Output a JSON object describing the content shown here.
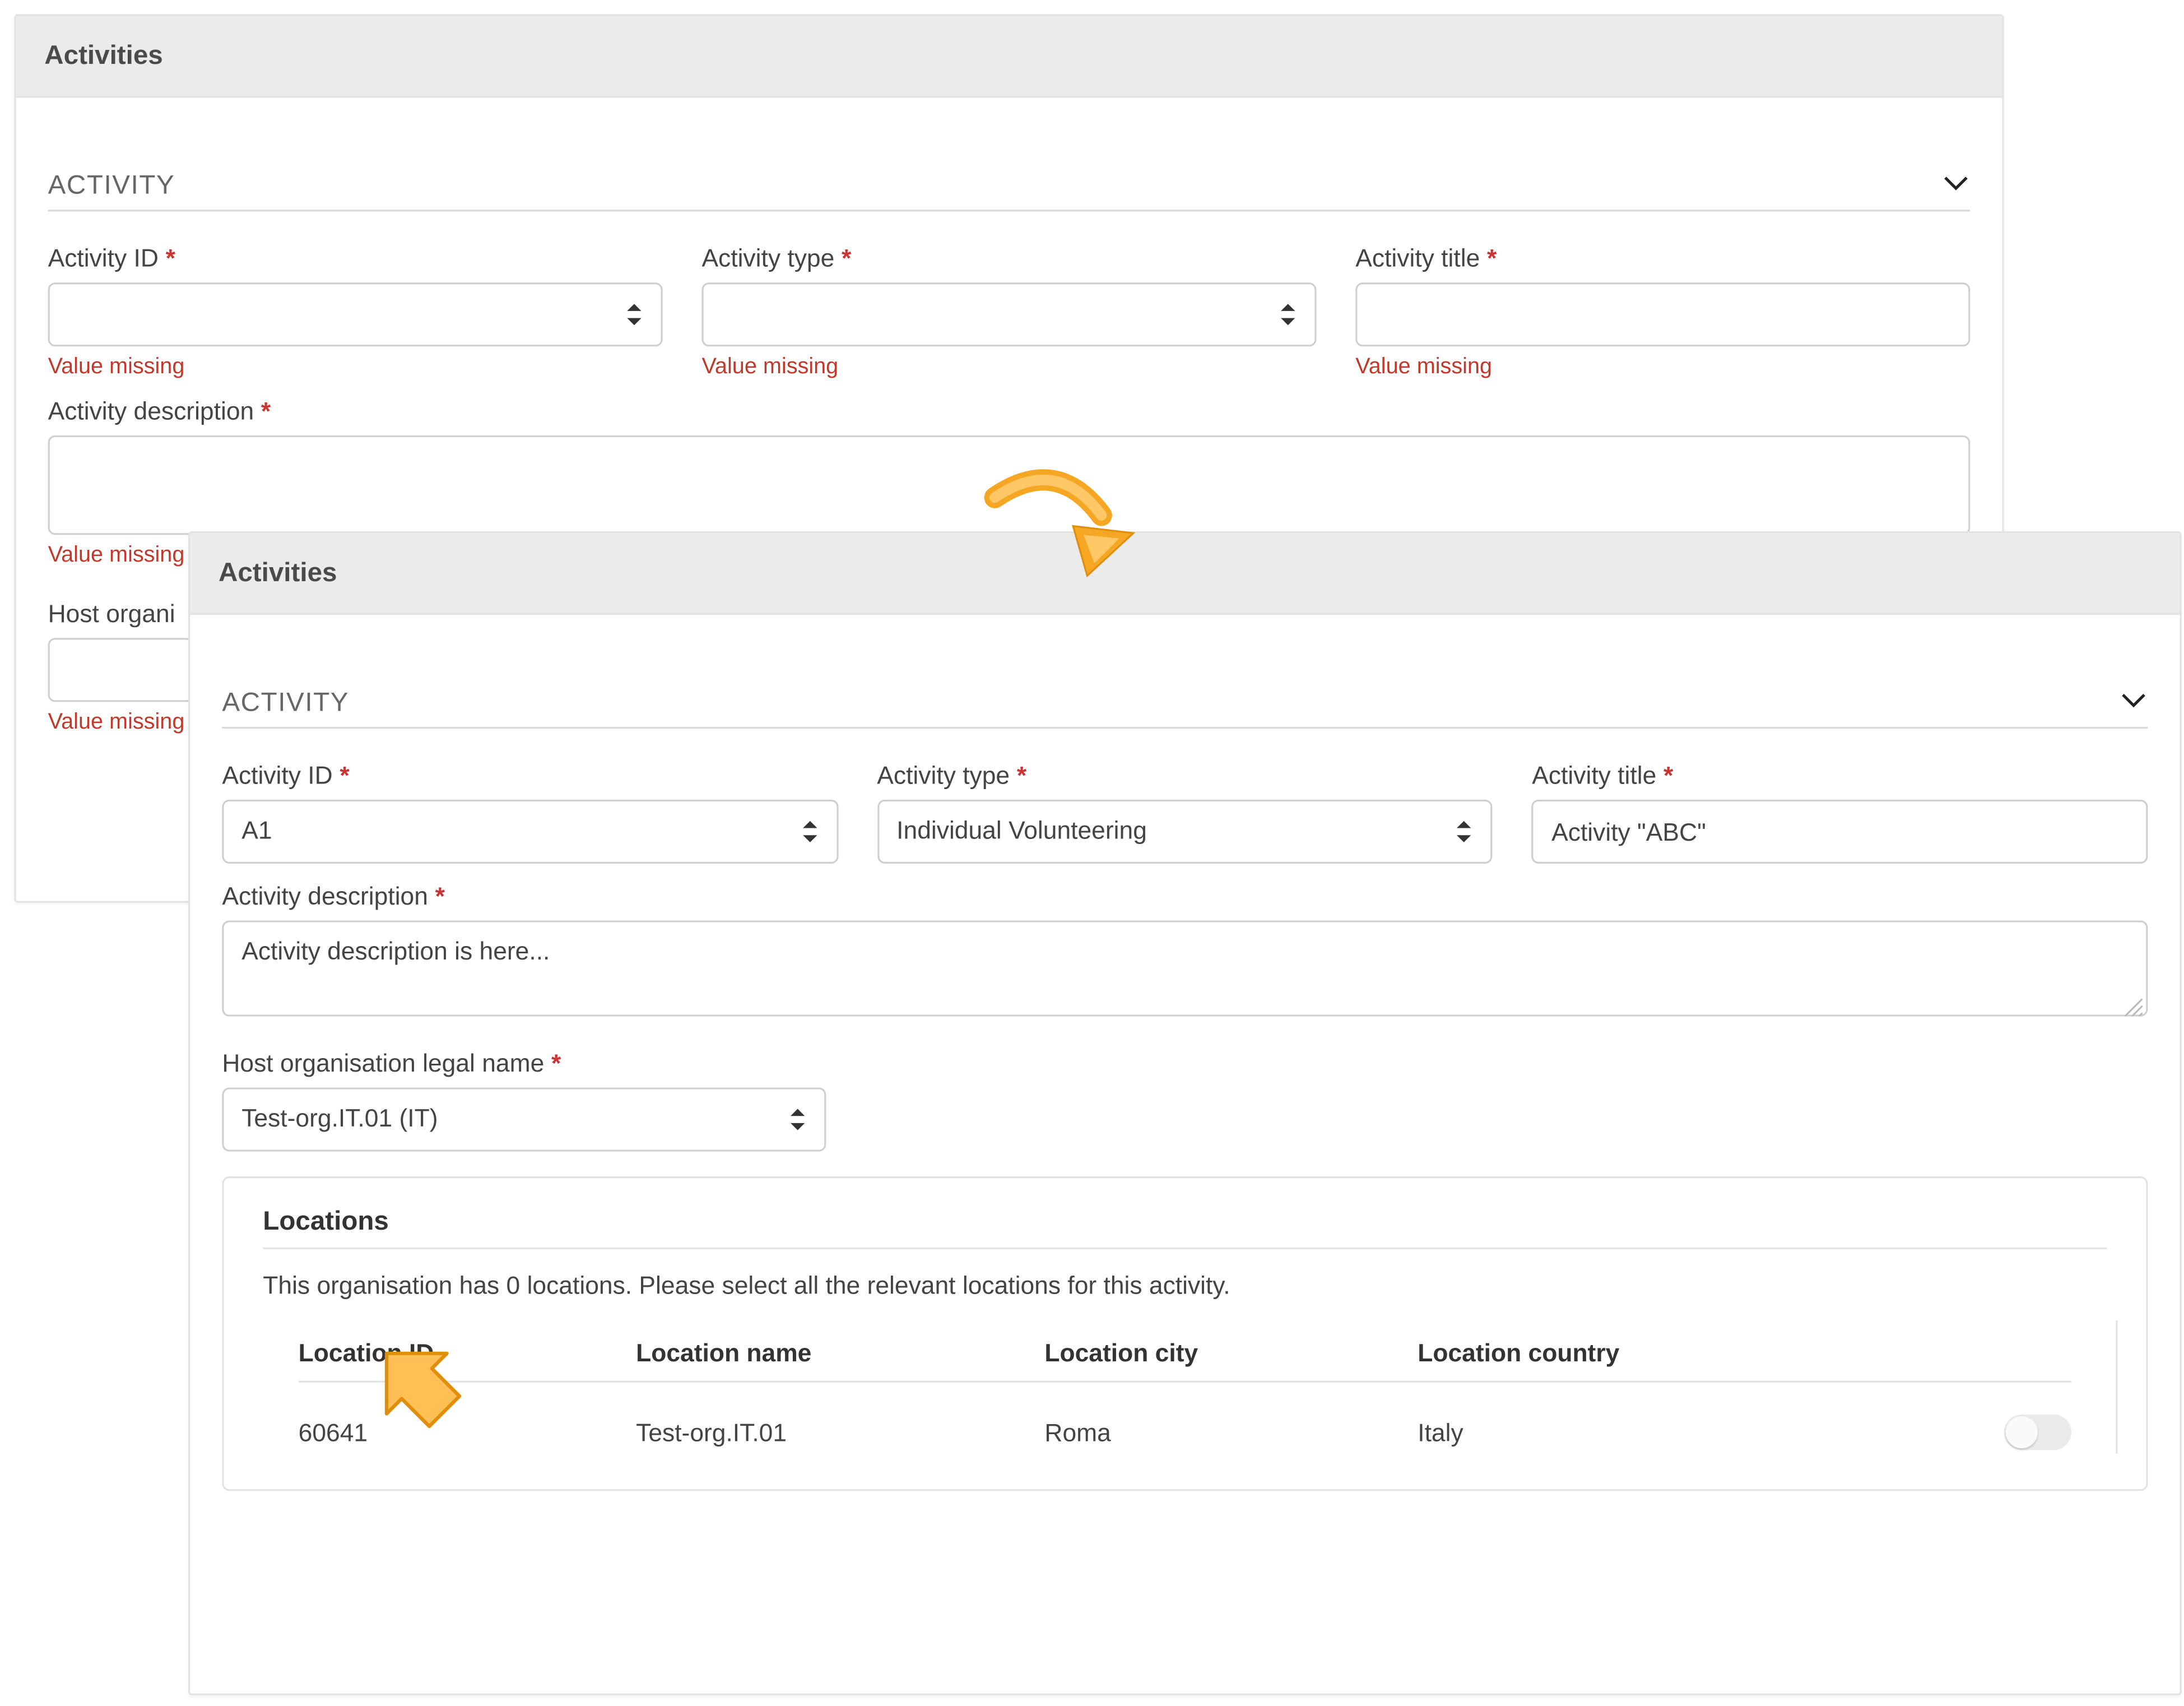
{
  "back_panel": {
    "header": "Activities",
    "section_title": "ACTIVITY",
    "fields": {
      "activity_id": {
        "label": "Activity ID",
        "error": "Value missing"
      },
      "activity_type": {
        "label": "Activity type",
        "error": "Value missing"
      },
      "activity_title": {
        "label": "Activity title",
        "error": "Value missing"
      },
      "activity_desc": {
        "label": "Activity description",
        "error": "Value missing"
      },
      "host_org": {
        "label_truncated": "Host organi",
        "error": "Value missing"
      }
    }
  },
  "front_panel": {
    "header": "Activities",
    "section_title": "ACTIVITY",
    "fields": {
      "activity_id": {
        "label": "Activity ID",
        "value": "A1"
      },
      "activity_type": {
        "label": "Activity type",
        "value": "Individual Volunteering"
      },
      "activity_title": {
        "label": "Activity title",
        "value": "Activity \"ABC\""
      },
      "activity_desc": {
        "label": "Activity description",
        "value": "Activity description is here..."
      },
      "host_org": {
        "label": "Host organisation legal name",
        "value": "Test-org.IT.01 (IT)"
      }
    },
    "locations": {
      "title": "Locations",
      "message": "This organisation has 0 locations. Please select all the relevant locations for this activity.",
      "headers": {
        "id": "Location ID",
        "name": "Location name",
        "city": "Location city",
        "country": "Location country"
      },
      "rows": [
        {
          "id": "60641",
          "name": "Test-org.IT.01",
          "city": "Roma",
          "country": "Italy",
          "selected": false
        }
      ]
    }
  }
}
